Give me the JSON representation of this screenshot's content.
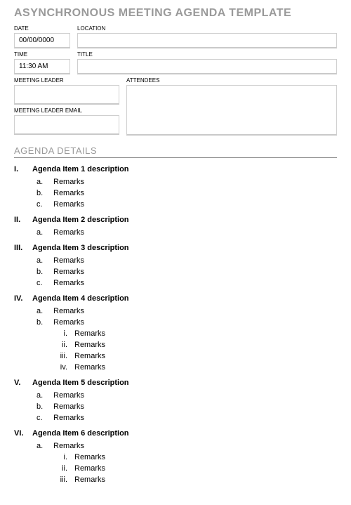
{
  "title": "ASYNCHRONOUS MEETING AGENDA TEMPLATE",
  "labels": {
    "date": "DATE",
    "location": "LOCATION",
    "time": "TIME",
    "title_field": "TITLE",
    "meeting_leader": "MEETING LEADER",
    "attendees": "ATTENDEES",
    "meeting_leader_email": "MEETING LEADER EMAIL"
  },
  "values": {
    "date": "00/00/0000",
    "location": "",
    "time": "11:30 AM",
    "title_field": "",
    "meeting_leader": "",
    "attendees": "",
    "meeting_leader_email": ""
  },
  "section": "AGENDA DETAILS",
  "agenda": [
    {
      "title": "Agenda Item 1 description",
      "remarks": [
        {
          "text": "Remarks"
        },
        {
          "text": "Remarks"
        },
        {
          "text": "Remarks"
        }
      ]
    },
    {
      "title": "Agenda Item 2 description",
      "remarks": [
        {
          "text": "Remarks"
        }
      ]
    },
    {
      "title": "Agenda Item 3 description",
      "remarks": [
        {
          "text": "Remarks"
        },
        {
          "text": "Remarks"
        },
        {
          "text": "Remarks"
        }
      ]
    },
    {
      "title": "Agenda Item 4 description",
      "remarks": [
        {
          "text": "Remarks"
        },
        {
          "text": "Remarks",
          "sub": [
            {
              "text": "Remarks"
            },
            {
              "text": "Remarks"
            },
            {
              "text": "Remarks"
            },
            {
              "text": "Remarks"
            }
          ]
        }
      ]
    },
    {
      "title": "Agenda Item 5 description",
      "remarks": [
        {
          "text": "Remarks"
        },
        {
          "text": "Remarks"
        },
        {
          "text": "Remarks"
        }
      ]
    },
    {
      "title": "Agenda Item 6 description",
      "remarks": [
        {
          "text": "Remarks",
          "sub": [
            {
              "text": "Remarks"
            },
            {
              "text": "Remarks"
            },
            {
              "text": "Remarks"
            }
          ]
        }
      ]
    }
  ]
}
